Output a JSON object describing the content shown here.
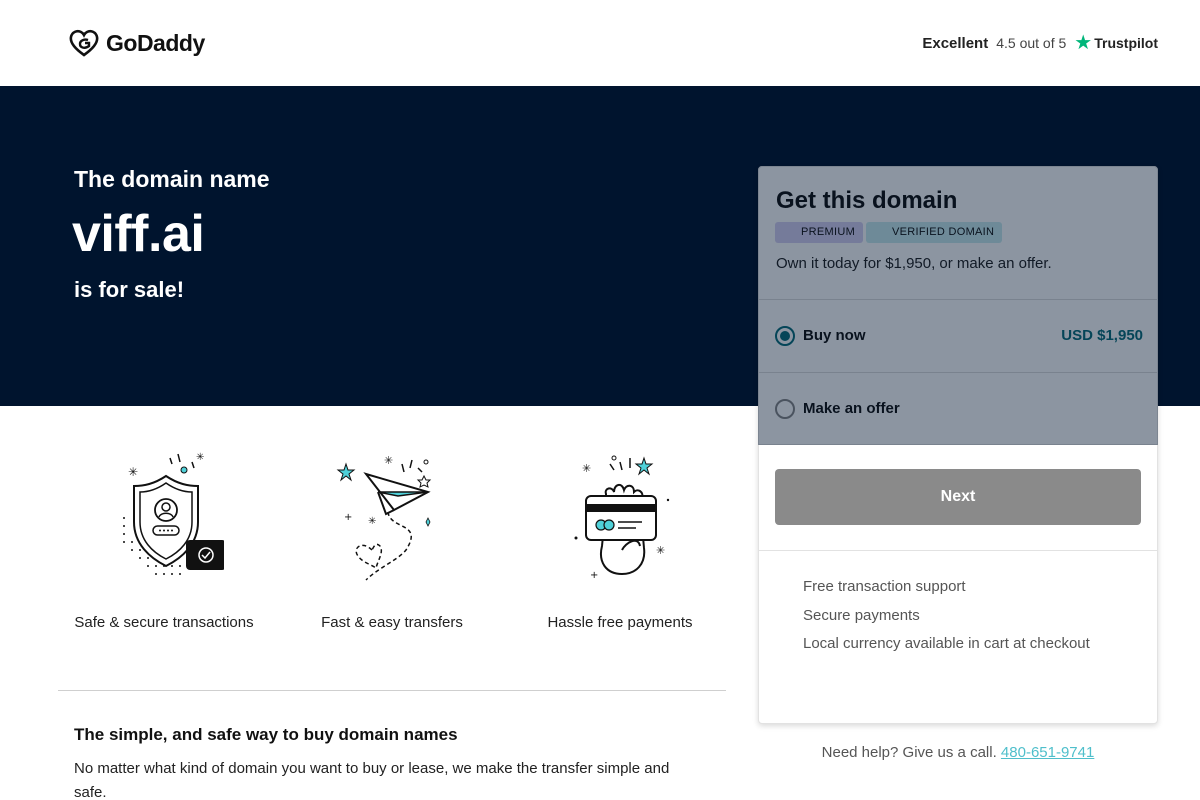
{
  "header": {
    "logo_text": "GoDaddy",
    "trust_rating_word": "Excellent",
    "trust_score": "4.5 out of 5",
    "trust_brand": "Trustpilot",
    "trust_star_icon": "star-icon",
    "trust_star_color": "#00b67a"
  },
  "hero": {
    "pre_text": "The domain name",
    "domain": "viff.ai",
    "post_text": "is for sale!",
    "background": "#00142e"
  },
  "features": [
    {
      "label": "Safe & secure transactions",
      "icon": "shield-user-icon"
    },
    {
      "label": "Fast & easy transfers",
      "icon": "paper-plane-icon"
    },
    {
      "label": "Hassle free payments",
      "icon": "hand-card-icon"
    }
  ],
  "about": {
    "title": "The simple, and safe way to buy domain names",
    "text": "No matter what kind of domain you want to buy or lease, we make the transfer simple and safe."
  },
  "card": {
    "title": "Get this domain",
    "badges": [
      "PREMIUM",
      "VERIFIED DOMAIN"
    ],
    "subtitle": "Own it today for $1,950, or make an offer.",
    "options": [
      {
        "label": "Buy now",
        "price": "USD $1,950",
        "selected": true
      },
      {
        "label": "Make an offer",
        "selected": false
      }
    ],
    "next_label": "Next",
    "perks": [
      "Free transaction support",
      "Secure payments",
      "Local currency available in cart at checkout"
    ],
    "accent_color": "#0a6e7b"
  },
  "help": {
    "text": "Need help? Give us a call.",
    "phone": "480-651-9741"
  }
}
